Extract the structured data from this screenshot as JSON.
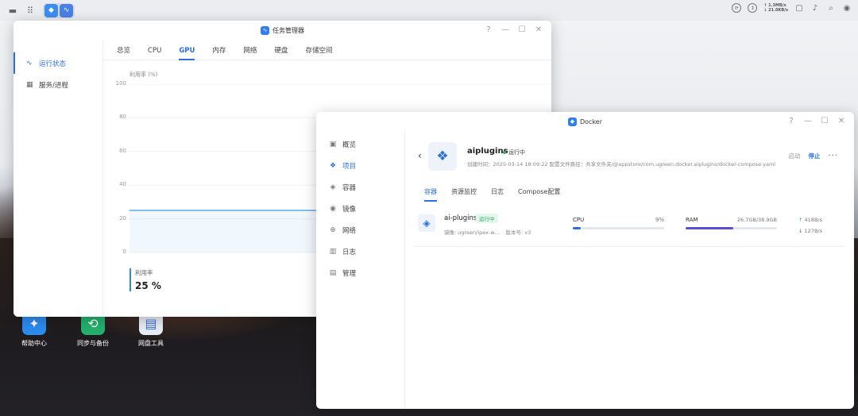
{
  "taskbar": {
    "net_up": "↑ 1.3MB/s",
    "net_down": "↓ 21.0KB/s"
  },
  "desktop": {
    "icons": [
      {
        "label": "帮助中心",
        "color": "#2d8cf0"
      },
      {
        "label": "同步与备份",
        "color": "#23b26d"
      },
      {
        "label": "网盘工具",
        "color": "#3a6fe0"
      }
    ]
  },
  "task_manager": {
    "title": "任务管理器",
    "sidebar": [
      {
        "label": "运行状态",
        "icon": "activity-icon"
      },
      {
        "label": "服务/进程",
        "icon": "grid-icon"
      }
    ],
    "tabs": [
      "总览",
      "CPU",
      "GPU",
      "内存",
      "网络",
      "硬盘",
      "存储空间"
    ],
    "active_tab": "GPU",
    "chart_ylabel": "利用率 (%)",
    "util_label": "利用率",
    "util_value": "25 %"
  },
  "chart_data": {
    "type": "line",
    "title": "",
    "xlabel": "",
    "ylabel": "利用率 (%)",
    "ylim": [
      0,
      100
    ],
    "yticks": [
      100,
      80,
      60,
      40,
      20,
      0
    ],
    "grid": true,
    "series": [
      {
        "values": [
          25,
          25,
          25,
          25,
          25,
          25,
          25,
          25,
          25,
          25,
          25,
          25,
          22,
          22,
          23,
          25,
          25,
          25,
          25,
          25,
          25,
          25,
          25,
          25,
          25
        ]
      }
    ]
  },
  "docker": {
    "title": "Docker",
    "sidebar": [
      {
        "label": "概览",
        "icon": "dashboard-icon"
      },
      {
        "label": "项目",
        "icon": "project-icon"
      },
      {
        "label": "容器",
        "icon": "container-icon"
      },
      {
        "label": "镜像",
        "icon": "image-icon"
      },
      {
        "label": "网络",
        "icon": "network-icon"
      },
      {
        "label": "日志",
        "icon": "log-icon"
      },
      {
        "label": "管理",
        "icon": "manage-icon"
      }
    ],
    "active_item": "项目",
    "project": {
      "name": "aiplugins",
      "status": "运行中",
      "meta": "创建时间：2025-03-14 18:09:22    配置文件路径：共享文件夹/@appstore/com.ugreen.docker.aiplugins/docker-compose.yaml",
      "start_label": "启动",
      "stop_label": "停止",
      "more_label": "···"
    },
    "tabs": [
      "容器",
      "资源监控",
      "日志",
      "Compose配置"
    ],
    "container": {
      "name": "ai-plugins",
      "status": "运行中",
      "image": "镜像: ugreen/ipex-w...",
      "version": "版本号: v3",
      "cpu_label": "CPU",
      "cpu_value": "9%",
      "cpu_fraction": 0.09,
      "ram_label": "RAM",
      "ram_value": "26.7GB/38.9GB",
      "ram_fraction": 0.52,
      "up": "418B/s",
      "down": "127B/s"
    }
  }
}
